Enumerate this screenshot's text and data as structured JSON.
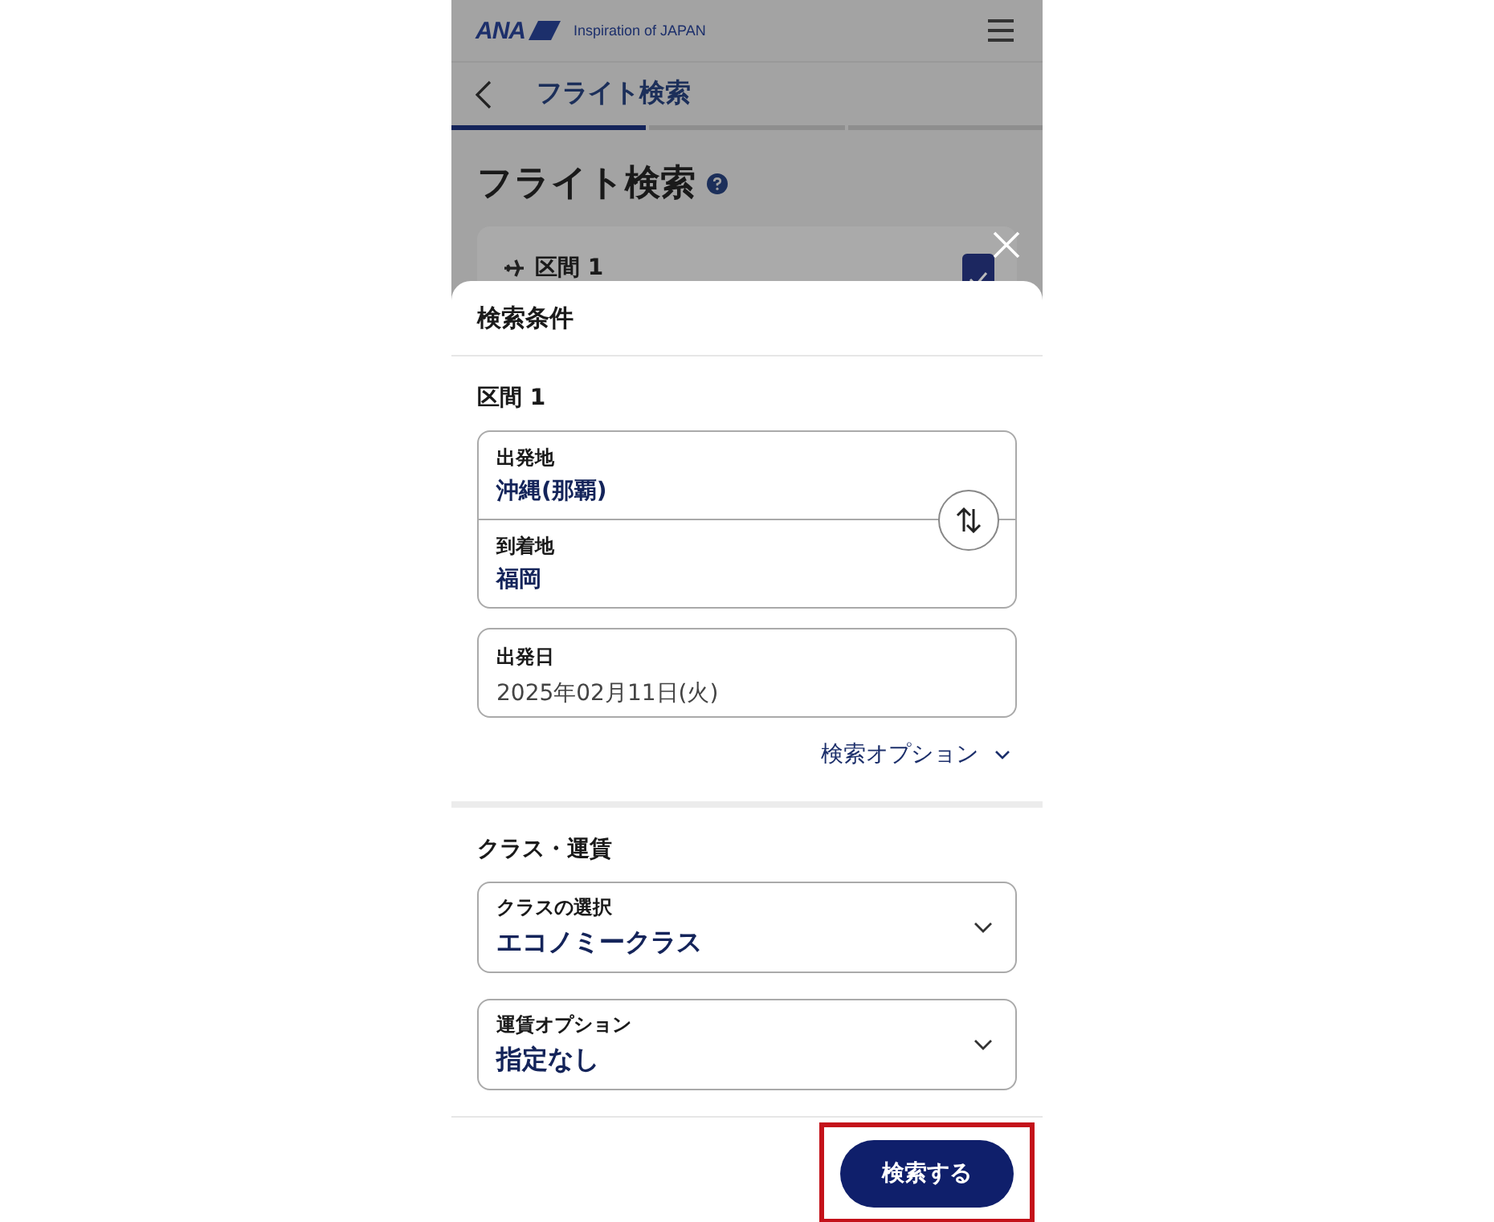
{
  "header": {
    "logo": "ANA",
    "tagline": "Inspiration of JAPAN"
  },
  "nav": {
    "title": "フライト検索"
  },
  "steps": [
    {
      "selected": true
    },
    {
      "selected": false
    },
    {
      "selected": false
    }
  ],
  "page_title": "フライト検索",
  "segment_card": {
    "label": "区間 1",
    "checked": true
  },
  "sheet": {
    "title": "検索条件",
    "route_section": {
      "title": "区間 1",
      "departure": {
        "label": "出発地",
        "value": "沖縄(那覇)"
      },
      "arrival": {
        "label": "到着地",
        "value": "福岡"
      },
      "date": {
        "label": "出発日",
        "value": "2025年02月11日(火)"
      },
      "options_link": "検索オプション"
    },
    "class_section": {
      "title": "クラス・運賃",
      "selects": [
        {
          "label": "クラスの選択",
          "value": "エコノミークラス"
        },
        {
          "label": "運賃オプション",
          "value": "指定なし"
        }
      ]
    },
    "submit": {
      "label": "検索する",
      "highlighted": true
    }
  }
}
